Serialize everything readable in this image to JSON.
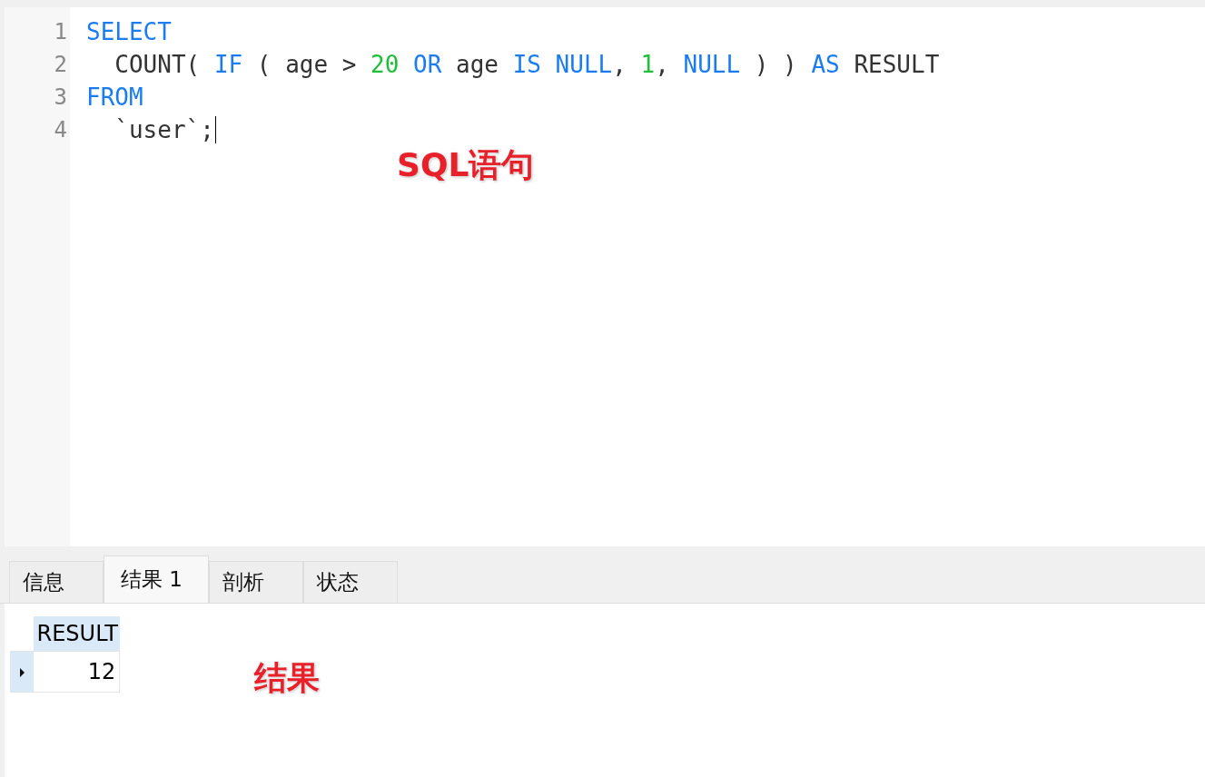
{
  "editor": {
    "lines": [
      {
        "number": "1",
        "tokens": [
          {
            "kind": "keyword",
            "text": "SELECT"
          }
        ]
      },
      {
        "number": "2",
        "tokens": [
          {
            "kind": "plain",
            "text": "  COUNT( "
          },
          {
            "kind": "keyword",
            "text": "IF"
          },
          {
            "kind": "plain",
            "text": " ( age > "
          },
          {
            "kind": "number",
            "text": "20"
          },
          {
            "kind": "keyword",
            "text": " OR"
          },
          {
            "kind": "plain",
            "text": " age "
          },
          {
            "kind": "keyword",
            "text": "IS NULL"
          },
          {
            "kind": "plain",
            "text": ", "
          },
          {
            "kind": "number",
            "text": "1"
          },
          {
            "kind": "plain",
            "text": ", "
          },
          {
            "kind": "keyword",
            "text": "NULL"
          },
          {
            "kind": "plain",
            "text": " ) ) "
          },
          {
            "kind": "keyword",
            "text": "AS"
          },
          {
            "kind": "plain",
            "text": " RESULT"
          }
        ]
      },
      {
        "number": "3",
        "tokens": [
          {
            "kind": "keyword",
            "text": "FROM"
          }
        ]
      },
      {
        "number": "4",
        "tokens": [
          {
            "kind": "plain",
            "text": "  `user`;"
          }
        ],
        "cursor": true
      }
    ],
    "annotation": "SQL语句"
  },
  "tabs": [
    {
      "label": "信息",
      "selected": false
    },
    {
      "label": "结果 1",
      "selected": true
    },
    {
      "label": "剖析",
      "selected": false
    },
    {
      "label": "状态",
      "selected": false
    }
  ],
  "result": {
    "annotation": "结果",
    "columns": [
      "RESULT"
    ],
    "rows": [
      {
        "cells": [
          "12"
        ],
        "selected": true
      }
    ]
  }
}
